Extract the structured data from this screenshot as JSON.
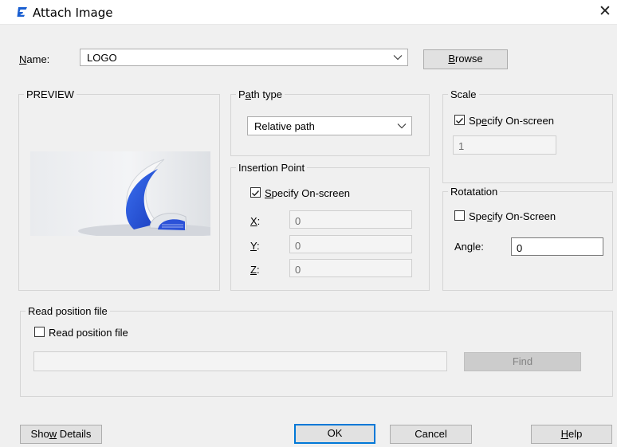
{
  "window": {
    "title": "Attach Image",
    "close_symbol": "✕"
  },
  "name_field": {
    "label_u": "N",
    "label_rest": "ame:",
    "value": "LOGO"
  },
  "browse_button": {
    "u": "B",
    "rest": "rowse"
  },
  "preview": {
    "legend": "PREVIEW"
  },
  "path_type": {
    "legend_pre": "P",
    "legend_u": "a",
    "legend_rest": "th type",
    "value": "Relative path"
  },
  "insertion_point": {
    "legend": "Insertion Point",
    "specify_u": "S",
    "specify_rest": "pecify On-screen",
    "checked": true,
    "x_u": "X",
    "y_u": "Y",
    "z_u": "Z",
    "colon": ":",
    "x": "0",
    "y": "0",
    "z": "0"
  },
  "scale": {
    "legend": "Scale",
    "specify_pre": "Sp",
    "specify_u": "e",
    "specify_rest": "cify On-screen",
    "checked": true,
    "value": "1"
  },
  "rotation": {
    "legend": "Rotatation",
    "specify_pre": "Spe",
    "specify_u": "c",
    "specify_rest": "ify On-Screen",
    "checked": false,
    "angle_pre": "An",
    "angle_u": "g",
    "angle_rest": "le:",
    "angle_value": "0"
  },
  "read_position": {
    "legend": "Read position file",
    "checkbox_label": "Read position file",
    "checked": false,
    "path_value": "",
    "find_label": "Find"
  },
  "footer": {
    "show_details_pre": "Sho",
    "show_details_u": "w",
    "show_details_rest": " Details",
    "ok": "OK",
    "cancel": "Cancel",
    "help_u": "H",
    "help_rest": "elp"
  },
  "colors": {
    "accent": "#0078d7",
    "app_icon": "#1a5fd1"
  }
}
